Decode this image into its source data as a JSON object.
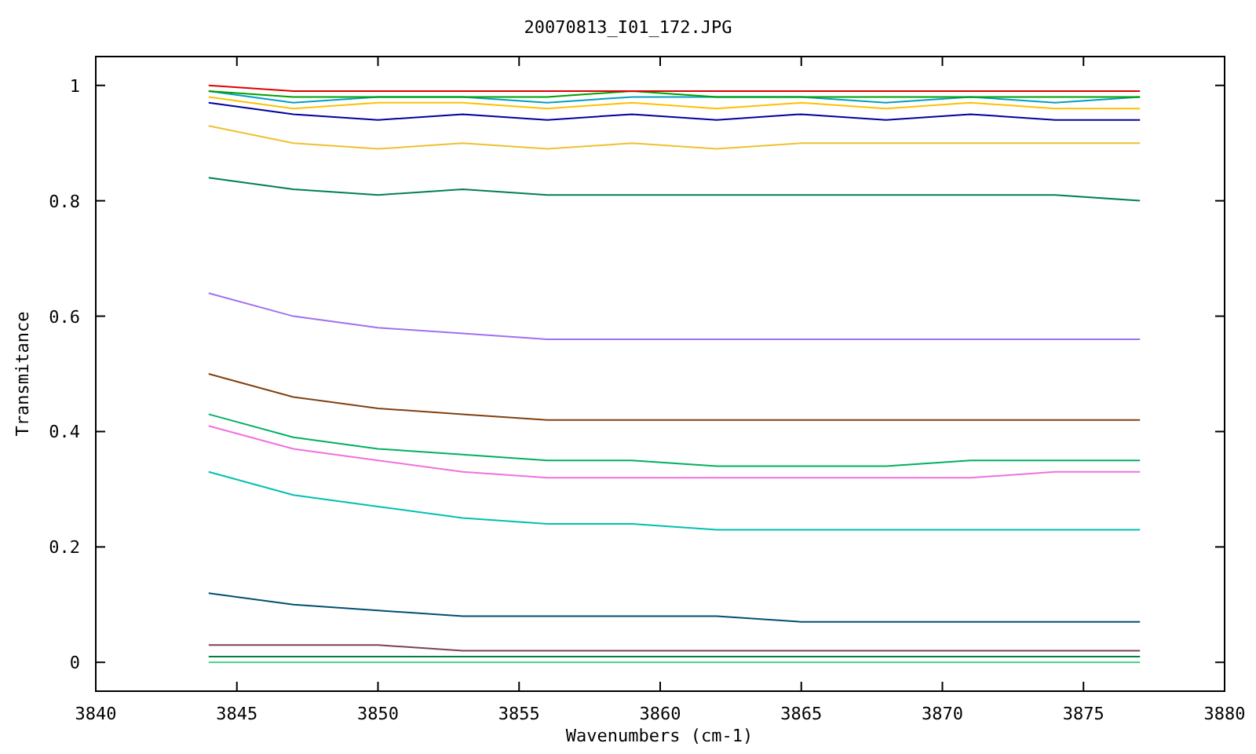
{
  "chart_data": {
    "type": "line",
    "title": "20070813_I01_172.JPG",
    "xlabel": "Wavenumbers (cm-1)",
    "ylabel": "Transmitance",
    "x": [
      3844,
      3847,
      3850,
      3853,
      3856,
      3859,
      3862,
      3865,
      3868,
      3871,
      3874,
      3877
    ],
    "xlim": [
      3840,
      3880
    ],
    "ylim": [
      -0.05,
      1.05
    ],
    "xticks": [
      3840,
      3845,
      3850,
      3855,
      3860,
      3865,
      3870,
      3875,
      3880
    ],
    "yticks": [
      0,
      0.2,
      0.4,
      0.6,
      0.8,
      1
    ],
    "series": [
      {
        "color": "#0000a0",
        "values": [
          0.97,
          0.95,
          0.94,
          0.95,
          0.94,
          0.95,
          0.94,
          0.95,
          0.94,
          0.95,
          0.94,
          0.94
        ]
      },
      {
        "color": "#ffc000",
        "values": [
          0.98,
          0.96,
          0.97,
          0.97,
          0.96,
          0.97,
          0.96,
          0.97,
          0.96,
          0.97,
          0.96,
          0.96
        ]
      },
      {
        "color": "#00a0c0",
        "values": [
          0.99,
          0.97,
          0.98,
          0.98,
          0.97,
          0.98,
          0.98,
          0.98,
          0.97,
          0.98,
          0.97,
          0.98
        ]
      },
      {
        "color": "#00a000",
        "values": [
          0.99,
          0.98,
          0.98,
          0.98,
          0.98,
          0.99,
          0.98,
          0.98,
          0.98,
          0.98,
          0.98,
          0.98
        ]
      },
      {
        "color": "#e00000",
        "values": [
          1.0,
          0.99,
          0.99,
          0.99,
          0.99,
          0.99,
          0.99,
          0.99,
          0.99,
          0.99,
          0.99,
          0.99
        ]
      },
      {
        "color": "#f0c030",
        "values": [
          0.93,
          0.9,
          0.89,
          0.9,
          0.89,
          0.9,
          0.89,
          0.9,
          0.9,
          0.9,
          0.9,
          0.9
        ]
      },
      {
        "color": "#008050",
        "values": [
          0.84,
          0.82,
          0.81,
          0.82,
          0.81,
          0.81,
          0.81,
          0.81,
          0.81,
          0.81,
          0.81,
          0.8
        ]
      },
      {
        "color": "#a070f0",
        "values": [
          0.64,
          0.6,
          0.58,
          0.57,
          0.56,
          0.56,
          0.56,
          0.56,
          0.56,
          0.56,
          0.56,
          0.56
        ]
      },
      {
        "color": "#804010",
        "values": [
          0.5,
          0.46,
          0.44,
          0.43,
          0.42,
          0.42,
          0.42,
          0.42,
          0.42,
          0.42,
          0.42,
          0.42
        ]
      },
      {
        "color": "#00b060",
        "values": [
          0.43,
          0.39,
          0.37,
          0.36,
          0.35,
          0.35,
          0.34,
          0.34,
          0.34,
          0.35,
          0.35,
          0.35
        ]
      },
      {
        "color": "#f070e0",
        "values": [
          0.41,
          0.37,
          0.35,
          0.33,
          0.32,
          0.32,
          0.32,
          0.32,
          0.32,
          0.32,
          0.33,
          0.33
        ]
      },
      {
        "color": "#00c0b0",
        "values": [
          0.33,
          0.29,
          0.27,
          0.25,
          0.24,
          0.24,
          0.23,
          0.23,
          0.23,
          0.23,
          0.23,
          0.23
        ]
      },
      {
        "color": "#005070",
        "values": [
          0.12,
          0.1,
          0.09,
          0.08,
          0.08,
          0.08,
          0.08,
          0.07,
          0.07,
          0.07,
          0.07,
          0.07
        ]
      },
      {
        "color": "#804050",
        "values": [
          0.03,
          0.03,
          0.03,
          0.02,
          0.02,
          0.02,
          0.02,
          0.02,
          0.02,
          0.02,
          0.02,
          0.02
        ]
      },
      {
        "color": "#008040",
        "values": [
          0.01,
          0.01,
          0.01,
          0.01,
          0.01,
          0.01,
          0.01,
          0.01,
          0.01,
          0.01,
          0.01,
          0.01
        ]
      },
      {
        "color": "#40d080",
        "values": [
          0.0,
          0.0,
          0.0,
          0.0,
          0.0,
          0.0,
          0.0,
          0.0,
          0.0,
          0.0,
          0.0,
          0.0
        ]
      }
    ]
  }
}
